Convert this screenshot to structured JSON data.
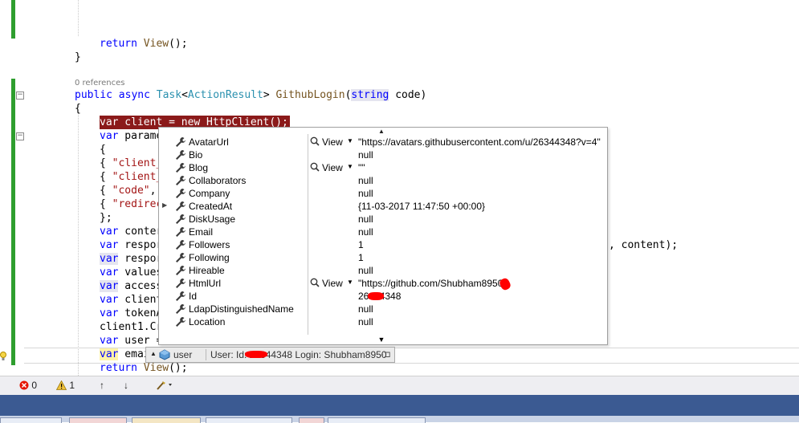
{
  "code": {
    "return_view_1": {
      "kw": "return",
      "fn": "View",
      "rest": "();"
    },
    "close_brace": "}",
    "references": "0 references",
    "signature": {
      "public": "public",
      "async": "async",
      "task": "Task",
      "lt": "<",
      "action": "ActionResult",
      "gt": ">",
      "name": "GithubLogin",
      "open": "(",
      "string": "string",
      "param": " code)"
    },
    "open_brace": "{",
    "line_client": {
      "kw": "var",
      "rest": " client = new HttpClient();"
    },
    "line_params": {
      "kw": "var",
      "rest": " parame"
    },
    "line_brace2": "{",
    "line_client_id": {
      "open": "{ ",
      "str": "\"client_"
    },
    "line_client_secret": {
      "open": "{ ",
      "str": "\"client_"
    },
    "line_code": {
      "open": "{ ",
      "str": "\"code\"",
      "rest": ","
    },
    "line_redirect": {
      "open": "{ ",
      "str": "\"redirec"
    },
    "line_close_list": "};",
    "line_content": {
      "kw": "var",
      "rest": " conter"
    },
    "line_response": {
      "kw": "var",
      "rest": " respor",
      "tail": ", content);"
    },
    "line_response2": {
      "kw": "var",
      "rest": " respor"
    },
    "line_values": {
      "kw": "var",
      "rest": " values"
    },
    "line_access": {
      "kw": "var",
      "rest": " access"
    },
    "line_client1": {
      "kw": "var",
      "rest": " client"
    },
    "line_token": {
      "kw": "var",
      "rest": " tokenA"
    },
    "line_client1cr": "client1.Cr",
    "line_user": {
      "kw": "var",
      "rest": " user ="
    },
    "line_email": {
      "kw": "var",
      "rest": " emai"
    },
    "return_view_2": {
      "kw": "return",
      "fn": "View",
      "rest": "();"
    }
  },
  "datatip": {
    "rows": [
      {
        "name": "AvatarUrl",
        "viewer": "View",
        "value": "\"https://avatars.githubusercontent.com/u/26344348?v=4\""
      },
      {
        "name": "Bio",
        "viewer": "",
        "value": "null"
      },
      {
        "name": "Blog",
        "viewer": "View",
        "value": "\"\""
      },
      {
        "name": "Collaborators",
        "viewer": "",
        "value": "null"
      },
      {
        "name": "Company",
        "viewer": "",
        "value": "null"
      },
      {
        "name": "CreatedAt",
        "viewer": "",
        "value": "{11-03-2017 11:47:50 +00:00}",
        "expandable": true
      },
      {
        "name": "DiskUsage",
        "viewer": "",
        "value": "null"
      },
      {
        "name": "Email",
        "viewer": "",
        "value": "null"
      },
      {
        "name": "Followers",
        "viewer": "",
        "value": "1"
      },
      {
        "name": "Following",
        "viewer": "",
        "value": "1"
      },
      {
        "name": "Hireable",
        "viewer": "",
        "value": "null"
      },
      {
        "name": "HtmlUrl",
        "viewer": "View",
        "value": "\"https://github.com/Shubham8950\""
      },
      {
        "name": "Id",
        "viewer": "",
        "value": "26344348"
      },
      {
        "name": "LdapDistinguishedName",
        "viewer": "",
        "value": "null"
      },
      {
        "name": "Location",
        "viewer": "",
        "value": "null"
      }
    ],
    "scroll_up": "▲",
    "scroll_down": "▼"
  },
  "hover": {
    "name": "user",
    "value": "User: Id: 26344348 Login: Shubham8950",
    "pin": "-⊐"
  },
  "status": {
    "errors": "0",
    "warnings": "1",
    "up_arrow": "↑",
    "down_arrow": "↓"
  },
  "colors": {
    "accent": "#3b5a92",
    "breakpoint_highlight": "#8b1a1a",
    "gutter_green": "#2e9e2e",
    "redaction": "#ff0000"
  }
}
